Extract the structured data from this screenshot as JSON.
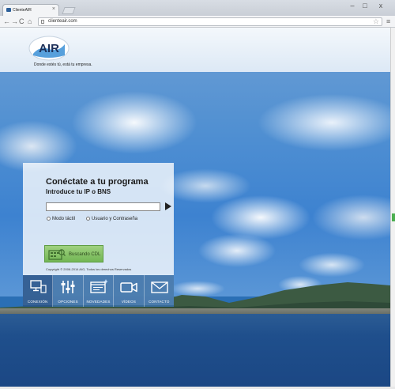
{
  "browser": {
    "tab_title": "ClienteAIR",
    "tab_close": "×",
    "url": "clienteair.com",
    "window": {
      "minimize": "–",
      "maximize": "□",
      "close": "x"
    },
    "nav": {
      "back": "←",
      "forward": "→",
      "reload": "C",
      "home": "⌂",
      "star": "☆",
      "menu": "≡"
    }
  },
  "header": {
    "logo_text": "AIR",
    "slogan": "Donde estés tú, está tu empresa."
  },
  "login": {
    "title": "Conéctate a tu programa",
    "subtitle": "Introduce tu IP o BNS",
    "ip_value": "",
    "options": [
      "Modo táctil",
      "Usuario y Contraseña"
    ],
    "cdl_button": "Buscando CDL",
    "copyright": "Copyright © 2006-2014 AIG, Todos los derechos Reservados"
  },
  "nav_items": [
    {
      "label": "CONEXIÓN",
      "icon": "monitor-icon"
    },
    {
      "label": "OPCIONES",
      "icon": "sliders-icon"
    },
    {
      "label": "NOVEDADES",
      "icon": "news-window-icon"
    },
    {
      "label": "VÍDEOS",
      "icon": "video-camera-icon"
    },
    {
      "label": "CONTACTO",
      "icon": "envelope-icon"
    }
  ],
  "colors": {
    "nav_blue": "#386ea6",
    "cdl_green": "#72b654",
    "sky_blue": "#4f8fd2",
    "sea_blue": "#1f4f8c"
  }
}
